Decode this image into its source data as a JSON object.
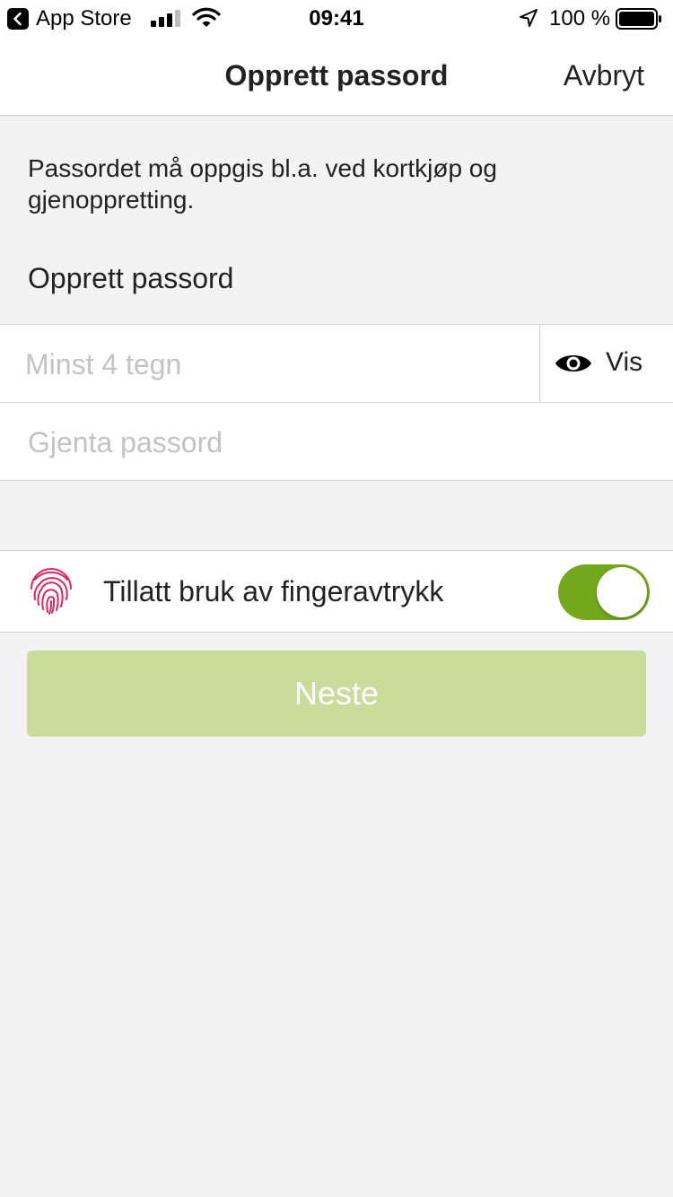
{
  "status_bar": {
    "carrier": "App Store",
    "time": "09:41",
    "battery": "100 %"
  },
  "nav": {
    "title": "Opprett passord",
    "cancel_label": "Avbryt"
  },
  "form": {
    "info_text": "Passordet må oppgis bl.a. ved kortkjøp og gjenoppretting.",
    "section_label": "Opprett passord",
    "password_value": "",
    "password_placeholder": "Minst 4 tegn",
    "show_label": "Vis",
    "repeat_value": "",
    "repeat_placeholder": "Gjenta passord"
  },
  "fingerprint": {
    "label": "Tillatt bruk av fingeravtrykk",
    "enabled": true
  },
  "next_button": {
    "label": "Neste"
  },
  "colors": {
    "accent_green": "#74a81c",
    "disabled_button": "#c9dc9c",
    "fingerprint_red": "#e0245e",
    "background": "#f3f3f3"
  },
  "icons": [
    "back-arrow-icon",
    "signal-icon",
    "wifi-icon",
    "location-arrow-icon",
    "battery-icon",
    "eye-icon",
    "fingerprint-icon"
  ]
}
